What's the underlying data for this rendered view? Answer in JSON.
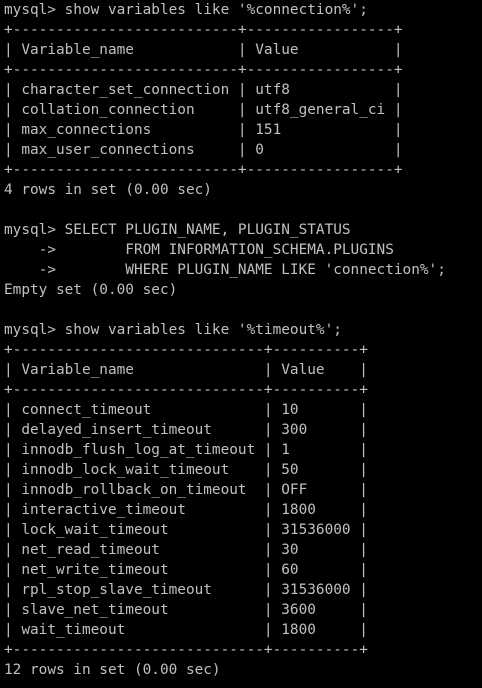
{
  "terminal": {
    "background": "#000000",
    "foreground": "#c0c0c0",
    "lines": [
      "mysql> show variables like '%connection%';",
      "+--------------------------+-----------------+",
      "| Variable_name            | Value           |",
      "+--------------------------+-----------------+",
      "| character_set_connection | utf8            |",
      "| collation_connection     | utf8_general_ci |",
      "| max_connections          | 151             |",
      "| max_user_connections     | 0               |",
      "+--------------------------+-----------------+",
      "4 rows in set (0.00 sec)",
      "",
      "mysql> SELECT PLUGIN_NAME, PLUGIN_STATUS",
      "    ->        FROM INFORMATION_SCHEMA.PLUGINS",
      "    ->        WHERE PLUGIN_NAME LIKE 'connection%';",
      "Empty set (0.00 sec)",
      "",
      "mysql> show variables like '%timeout%';",
      "+-----------------------------+----------+",
      "| Variable_name               | Value    |",
      "+-----------------------------+----------+",
      "| connect_timeout             | 10       |",
      "| delayed_insert_timeout      | 300      |",
      "| innodb_flush_log_at_timeout | 1        |",
      "| innodb_lock_wait_timeout    | 50       |",
      "| innodb_rollback_on_timeout  | OFF      |",
      "| interactive_timeout         | 1800     |",
      "| lock_wait_timeout           | 31536000 |",
      "| net_read_timeout            | 30       |",
      "| net_write_timeout           | 60       |",
      "| rpl_stop_slave_timeout      | 31536000 |",
      "| slave_net_timeout           | 3600     |",
      "| wait_timeout                | 1800     |",
      "+-----------------------------+----------+",
      "12 rows in set (0.00 sec)"
    ]
  }
}
